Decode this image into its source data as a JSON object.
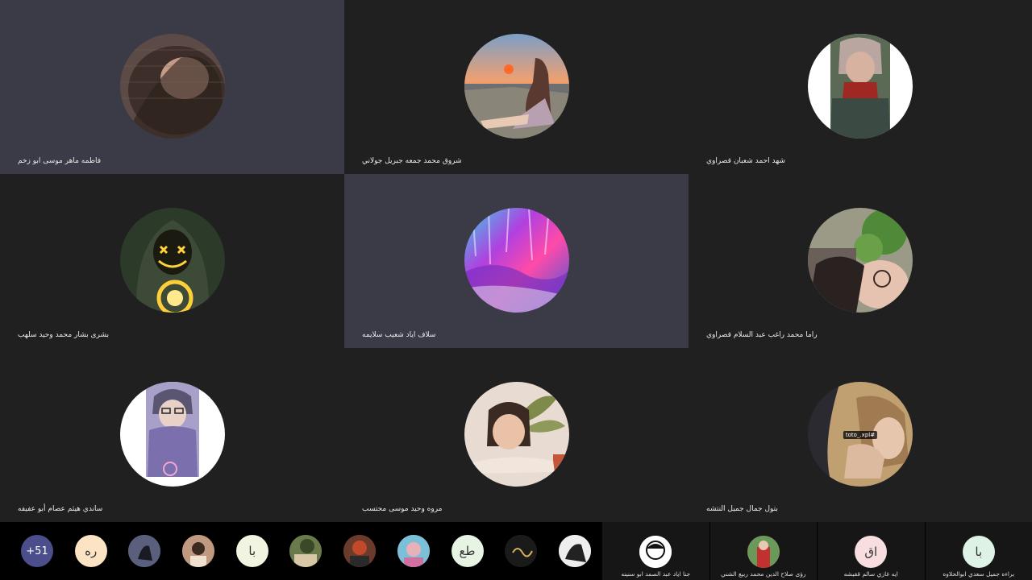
{
  "participants": [
    {
      "name": "فاطمه ماهر موسى ابو زخم",
      "icon": "portrait-photo-icon"
    },
    {
      "name": "شروق محمد جمعه جبريل جولاني",
      "icon": "sunset-photo-icon"
    },
    {
      "name": "شهد احمد شعبان قصراوي",
      "icon": "portrait-photo-icon"
    },
    {
      "name": "بشرى بشار محمد وحيد سلهب",
      "icon": "hooded-figure-icon"
    },
    {
      "name": "سلاف اياد شعيب سلايمه",
      "icon": "abstract-art-icon"
    },
    {
      "name": "راما محمد راغب عبد السلام قصراوي",
      "icon": "portrait-photo-icon"
    },
    {
      "name": "ساندي هيثم عصام أبو عفيفه",
      "icon": "portrait-photo-icon"
    },
    {
      "name": "مروه وحيد موسى محتسب",
      "icon": "illustrated-girl-icon"
    },
    {
      "name": "بتول جمال جميل النتشه",
      "icon": "portrait-photo-icon",
      "tag": "toto_.xpl#"
    }
  ],
  "strip": {
    "overflow_count": "+51",
    "small_avatars": [
      {
        "initials": "ره",
        "color": "#fbe3c3",
        "icon": ""
      },
      {
        "initials": "",
        "color": "#6a6f8e",
        "icon": "photo-avatar-icon"
      },
      {
        "initials": "",
        "color": "#a67f6b",
        "icon": "photo-avatar-icon"
      },
      {
        "initials": "با",
        "color": "#f0f4e0",
        "icon": ""
      },
      {
        "initials": "",
        "color": "#4a5a3a",
        "icon": "photo-avatar-icon"
      },
      {
        "initials": "",
        "color": "#8a3a2a",
        "icon": "photo-avatar-icon"
      },
      {
        "initials": "",
        "color": "#c86fa0",
        "icon": "photo-avatar-icon"
      },
      {
        "initials": "طع",
        "color": "#e7f4e4",
        "icon": ""
      },
      {
        "initials": "",
        "color": "#1a1a1a",
        "icon": "calligraphy-avatar-icon"
      },
      {
        "initials": "",
        "color": "#e6e6e6",
        "icon": "photo-avatar-icon"
      }
    ],
    "named": [
      {
        "name": "جنا اياد عبد الصمد ابو سنينه",
        "initials": "",
        "color": "#ffffff",
        "icon": "cartoon-avatar-icon"
      },
      {
        "name": "رؤى صلاح الدين محمد ربيع الشني",
        "initials": "",
        "color": "#c23030",
        "icon": "photo-avatar-icon"
      },
      {
        "name": "ايه غازي سالم قفيشه",
        "initials": "اق",
        "color": "#f8dede",
        "icon": ""
      },
      {
        "name": "براءه جميل سعدي ابوالحلاوه",
        "initials": "با",
        "color": "#dff2e6",
        "icon": ""
      }
    ]
  }
}
